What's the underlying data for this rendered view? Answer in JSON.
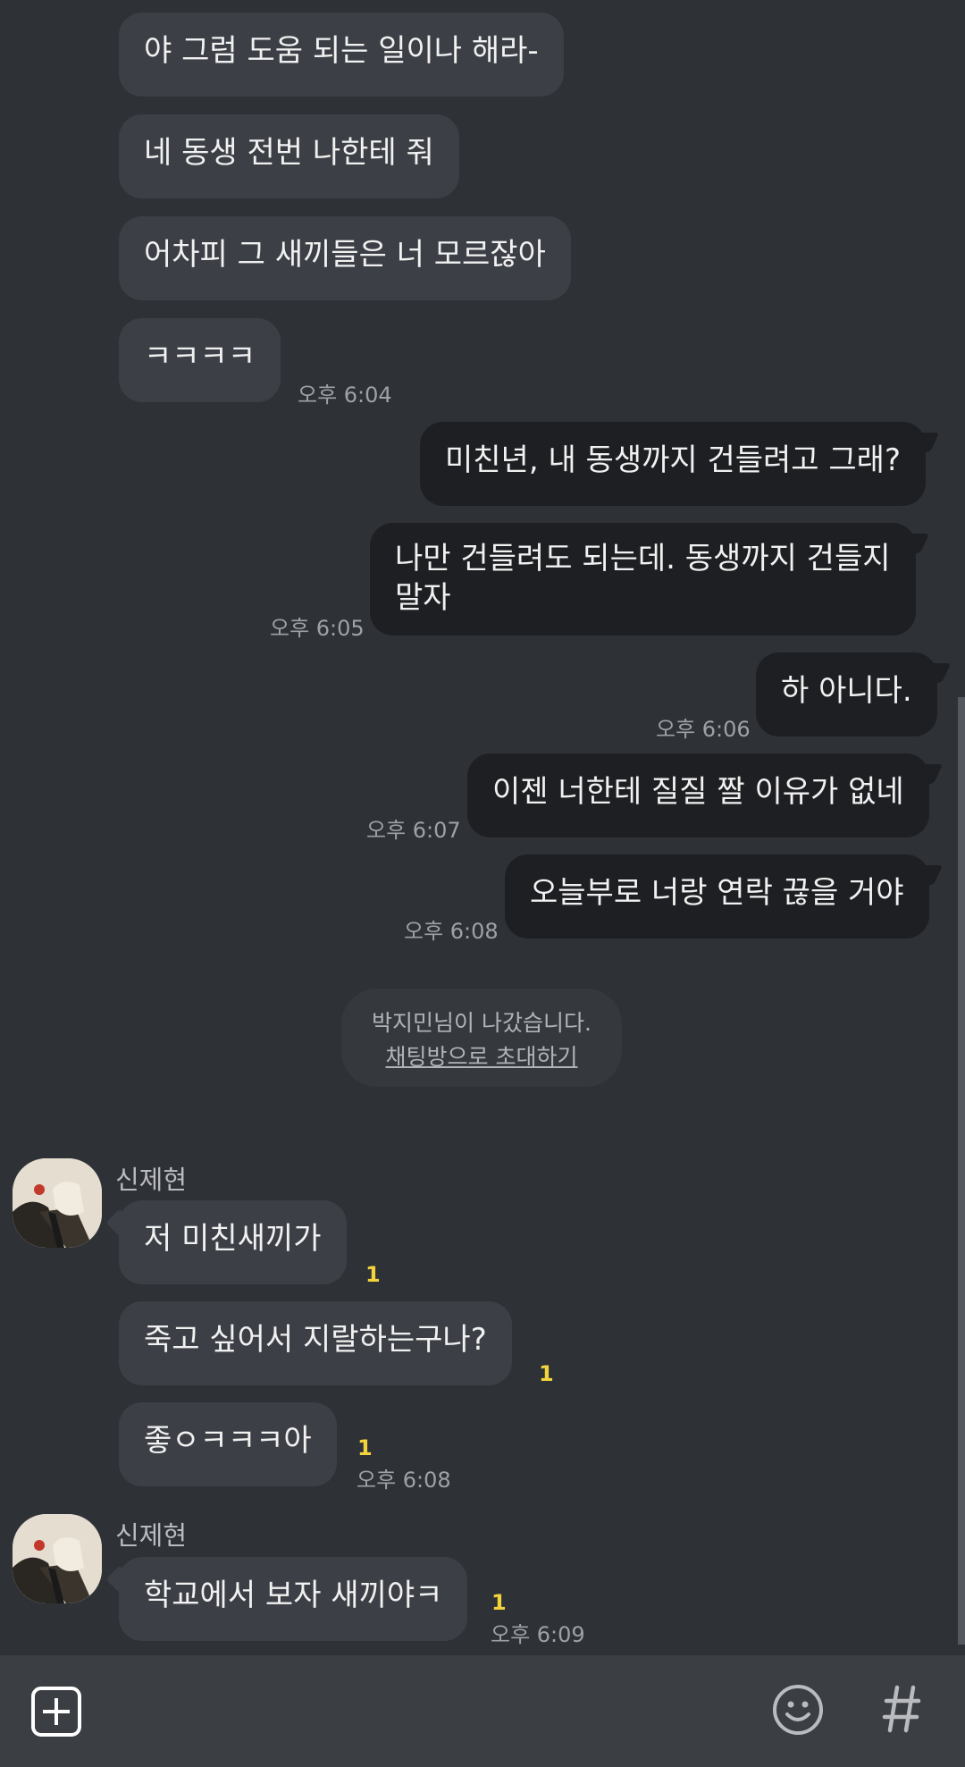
{
  "messages": {
    "m1": "야 그럼 도움 되는 일이나 해라-",
    "m2": "네 동생 전번 나한테 줘",
    "m3": "어차피 그 새끼들은 너 모르잖아",
    "m4": "ㅋㅋㅋㅋ",
    "m5": "미친년, 내 동생까지 건들려고 그래?",
    "m6a": "나만 건들려도 되는데. 동생까지 건들지",
    "m6b": "말자",
    "m7": "하 아니다.",
    "m8": "이젠 너한테 질질 짤 이유가 없네",
    "m9": "오늘부로 너랑 연락 끊을 거야",
    "m10": "저 미친새끼가",
    "m11": "죽고 싶어서 지랄하는구나?",
    "m12": "좋ㅇㅋㅋㅋ아",
    "m13": "학교에서 보자 새끼야ㅋ"
  },
  "times": {
    "t1": "오후 6:04",
    "t2": "오후 6:05",
    "t3": "오후 6:06",
    "t4": "오후 6:07",
    "t5": "오후 6:08",
    "t6": "오후 6:08",
    "t7": "오후 6:09"
  },
  "unread": {
    "count": "1"
  },
  "sender": {
    "name": "신제현"
  },
  "system": {
    "left_notice": "박지민님이 나갔습니다.",
    "invite_link": "채팅방으로 초대하기"
  },
  "input_bar": {
    "plus_icon": "plus-square-icon",
    "emoji_icon": "smiley-icon",
    "hash_icon": "hash-icon"
  },
  "colors": {
    "background": "#2e3136",
    "incoming_bubble": "#3c3f45",
    "outgoing_bubble": "#1e1f22",
    "unread_count": "#f3d33c"
  }
}
